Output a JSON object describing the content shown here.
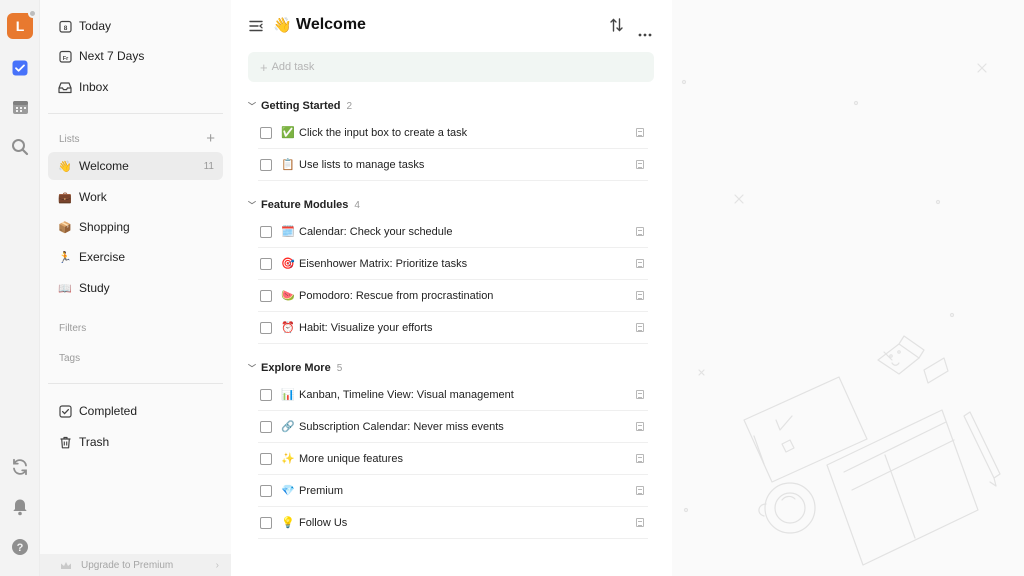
{
  "user": {
    "avatar_letter": "L"
  },
  "rail": {
    "icons": [
      "checkbox-icon",
      "calendar-icon",
      "search-icon",
      "sync-icon",
      "bell-icon",
      "help-icon"
    ]
  },
  "sidebar": {
    "smart_lists": [
      {
        "label": "Today",
        "icon": "today-icon"
      },
      {
        "label": "Next 7 Days",
        "icon": "next7-icon"
      },
      {
        "label": "Inbox",
        "icon": "inbox-icon"
      }
    ],
    "lists_label": "Lists",
    "lists": [
      {
        "emoji": "👋",
        "label": "Welcome",
        "count": "11",
        "active": true
      },
      {
        "emoji": "💼",
        "label": "Work"
      },
      {
        "emoji": "📦",
        "label": "Shopping"
      },
      {
        "emoji": "🏃",
        "label": "Exercise"
      },
      {
        "emoji": "📖",
        "label": "Study"
      }
    ],
    "filters_label": "Filters",
    "tags_label": "Tags",
    "bottom": [
      {
        "label": "Completed",
        "icon": "completed-icon"
      },
      {
        "label": "Trash",
        "icon": "trash-icon"
      }
    ],
    "upgrade_label": "Upgrade to Premium"
  },
  "main": {
    "title_emoji": "👋",
    "title": "Welcome",
    "add_placeholder": "Add task",
    "groups": [
      {
        "name": "Getting Started",
        "count": "2",
        "tasks": [
          {
            "emoji": "✅",
            "text": "Click the input box to create a task"
          },
          {
            "emoji": "📋",
            "text": "Use lists to manage tasks"
          }
        ]
      },
      {
        "name": "Feature Modules",
        "count": "4",
        "tasks": [
          {
            "emoji": "🗓️",
            "text": "Calendar: Check your schedule"
          },
          {
            "emoji": "🎯",
            "text": "Eisenhower Matrix: Prioritize tasks"
          },
          {
            "emoji": "🍉",
            "text": "Pomodoro: Rescue from procrastination"
          },
          {
            "emoji": "⏰",
            "text": "Habit: Visualize your efforts"
          }
        ]
      },
      {
        "name": "Explore More",
        "count": "5",
        "tasks": [
          {
            "emoji": "📊",
            "text": "Kanban, Timeline View: Visual management"
          },
          {
            "emoji": "🔗",
            "text": "Subscription Calendar: Never miss events"
          },
          {
            "emoji": "✨",
            "text": "More unique features"
          },
          {
            "emoji": "💎",
            "text": "Premium"
          },
          {
            "emoji": "💡",
            "text": "Follow Us"
          }
        ]
      }
    ]
  },
  "colors": {
    "accent": "#4772fa",
    "avatar": "#e8792f",
    "add_box_bg": "#f1f6f3"
  }
}
